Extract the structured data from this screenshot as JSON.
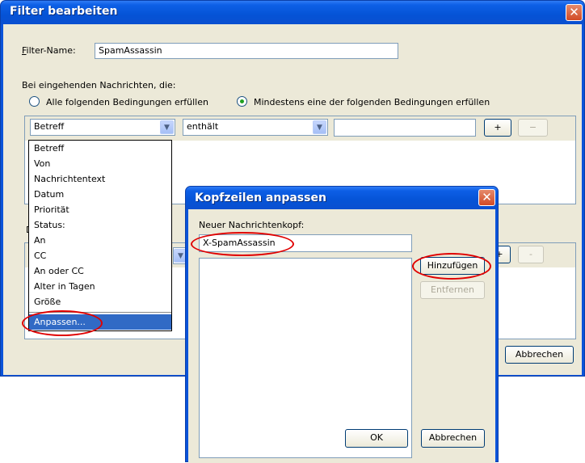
{
  "filter_dialog": {
    "title": "Filter bearbeiten",
    "close_glyph": "✕",
    "filter_name_label": "Filter-Name:",
    "filter_name_value": "SpamAssassin",
    "incoming_label": "Bei eingehenden Nachrichten, die:",
    "radio_all_label": "Alle folgenden Bedingungen erfüllen",
    "radio_any_label": "Mindestens eine der folgenden Bedingungen erfüllen",
    "condition_field": "Betreff",
    "condition_operator": "enthält",
    "condition_value": "",
    "add_row_label": "+",
    "remove_row_label": "−",
    "actions_label_initial": "D",
    "action_add_label": "+",
    "action_remove_label": "-",
    "cancel_label": "Abbrechen"
  },
  "field_dropdown": {
    "items": [
      "Betreff",
      "Von",
      "Nachrichtentext",
      "Datum",
      "Priorität",
      "Status:",
      "An",
      "CC",
      "An oder CC",
      "Alter in Tagen",
      "Größe"
    ],
    "customize_label": "Anpassen..."
  },
  "header_dialog": {
    "title": "Kopfzeilen anpassen",
    "close_glyph": "✕",
    "new_header_label": "Neuer Nachrichtenkopf:",
    "new_header_value": "X-SpamAssassin",
    "add_label": "Hinzufügen",
    "remove_label": "Entfernen",
    "ok_label": "OK",
    "cancel_label": "Abbrechen"
  },
  "colors": {
    "titlebar": "#0553d6",
    "dialog_face": "#ece9d8",
    "highlight": "#316ac5",
    "annotation": "#e00000"
  }
}
